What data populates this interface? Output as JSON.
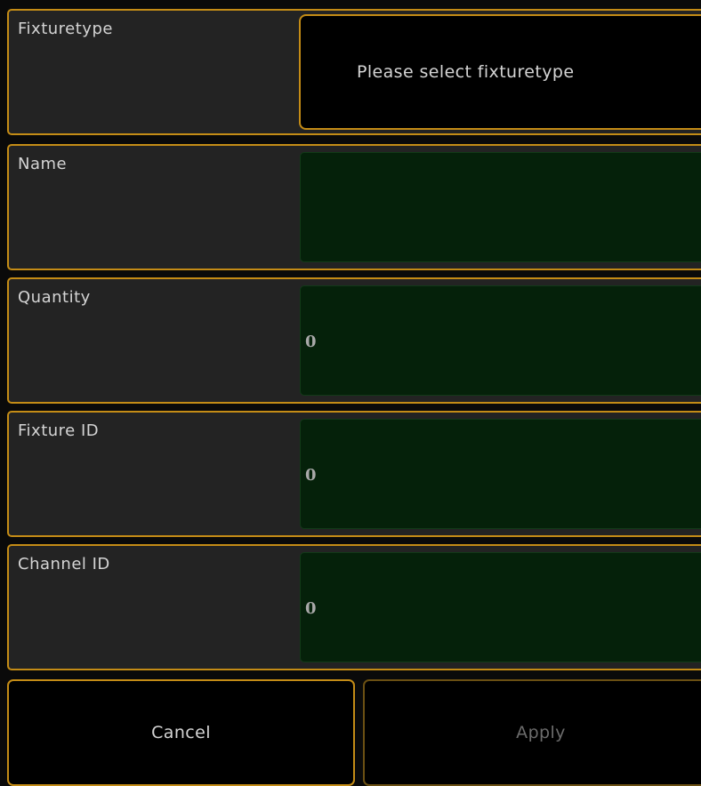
{
  "fixturetype": {
    "label": "Fixturetype",
    "select_text": "Please select fixturetype"
  },
  "name": {
    "label": "Name",
    "value": ""
  },
  "quantity": {
    "label": "Quantity",
    "value": "0"
  },
  "fixture_id": {
    "label": "Fixture ID",
    "value": "0"
  },
  "channel_id": {
    "label": "Channel ID",
    "value": "0"
  },
  "buttons": {
    "cancel_label": "Cancel",
    "apply_label": "Apply"
  },
  "colors": {
    "accent": "#c48c16",
    "field_bg": "#05210a",
    "row_bg": "#232323"
  }
}
